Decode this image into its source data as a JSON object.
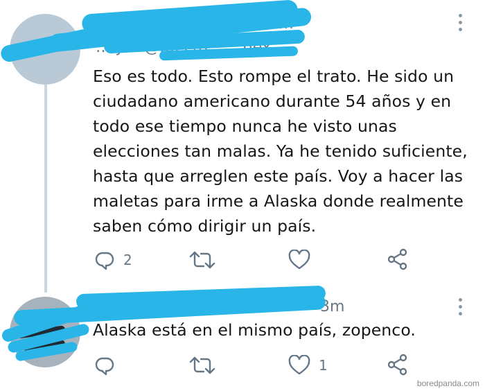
{
  "tweets": [
    {
      "header_visible": "…ly… @…ecto… …dex",
      "header_right": "…m",
      "text": "Eso es todo. Esto rompe el trato. He sido un ciudadano americano durante 54 años y en todo ese tiempo nunca he visto unas elecciones tan malas. Ya he tenido suficiente, hasta que arreglen este país. Voy a hacer las maletas para irme a Alaska donde realmente saben cómo dirigir un país.",
      "lines": [
        "Eso es todo. Esto rompe el trato. He sido un",
        "ciudadano americano durante 54 años y en",
        "todo ese tiempo nunca he visto unas",
        "elecciones tan malas. Ya he tenido suficiente,",
        "hasta que arreglen este país. Voy a hacer las",
        "maletas para irme a Alaska donde realmente",
        "saben cómo dirigir un país."
      ],
      "reply_count": "2",
      "retweet_count": "",
      "like_count": ""
    },
    {
      "header_visible": "…@…",
      "header_right": "3m",
      "text": "Alaska está en el mismo país, zopenco.",
      "reply_count": "",
      "retweet_count": "",
      "like_count": "1"
    }
  ],
  "icons": {
    "reply": "reply-icon",
    "retweet": "retweet-icon",
    "like": "heart-icon",
    "share": "share-icon",
    "more": "more-vertical-icon"
  },
  "colors": {
    "redaction": "#29b5e8",
    "icon": "#657786",
    "text": "#14171a"
  },
  "watermark": "boredpanda.com"
}
